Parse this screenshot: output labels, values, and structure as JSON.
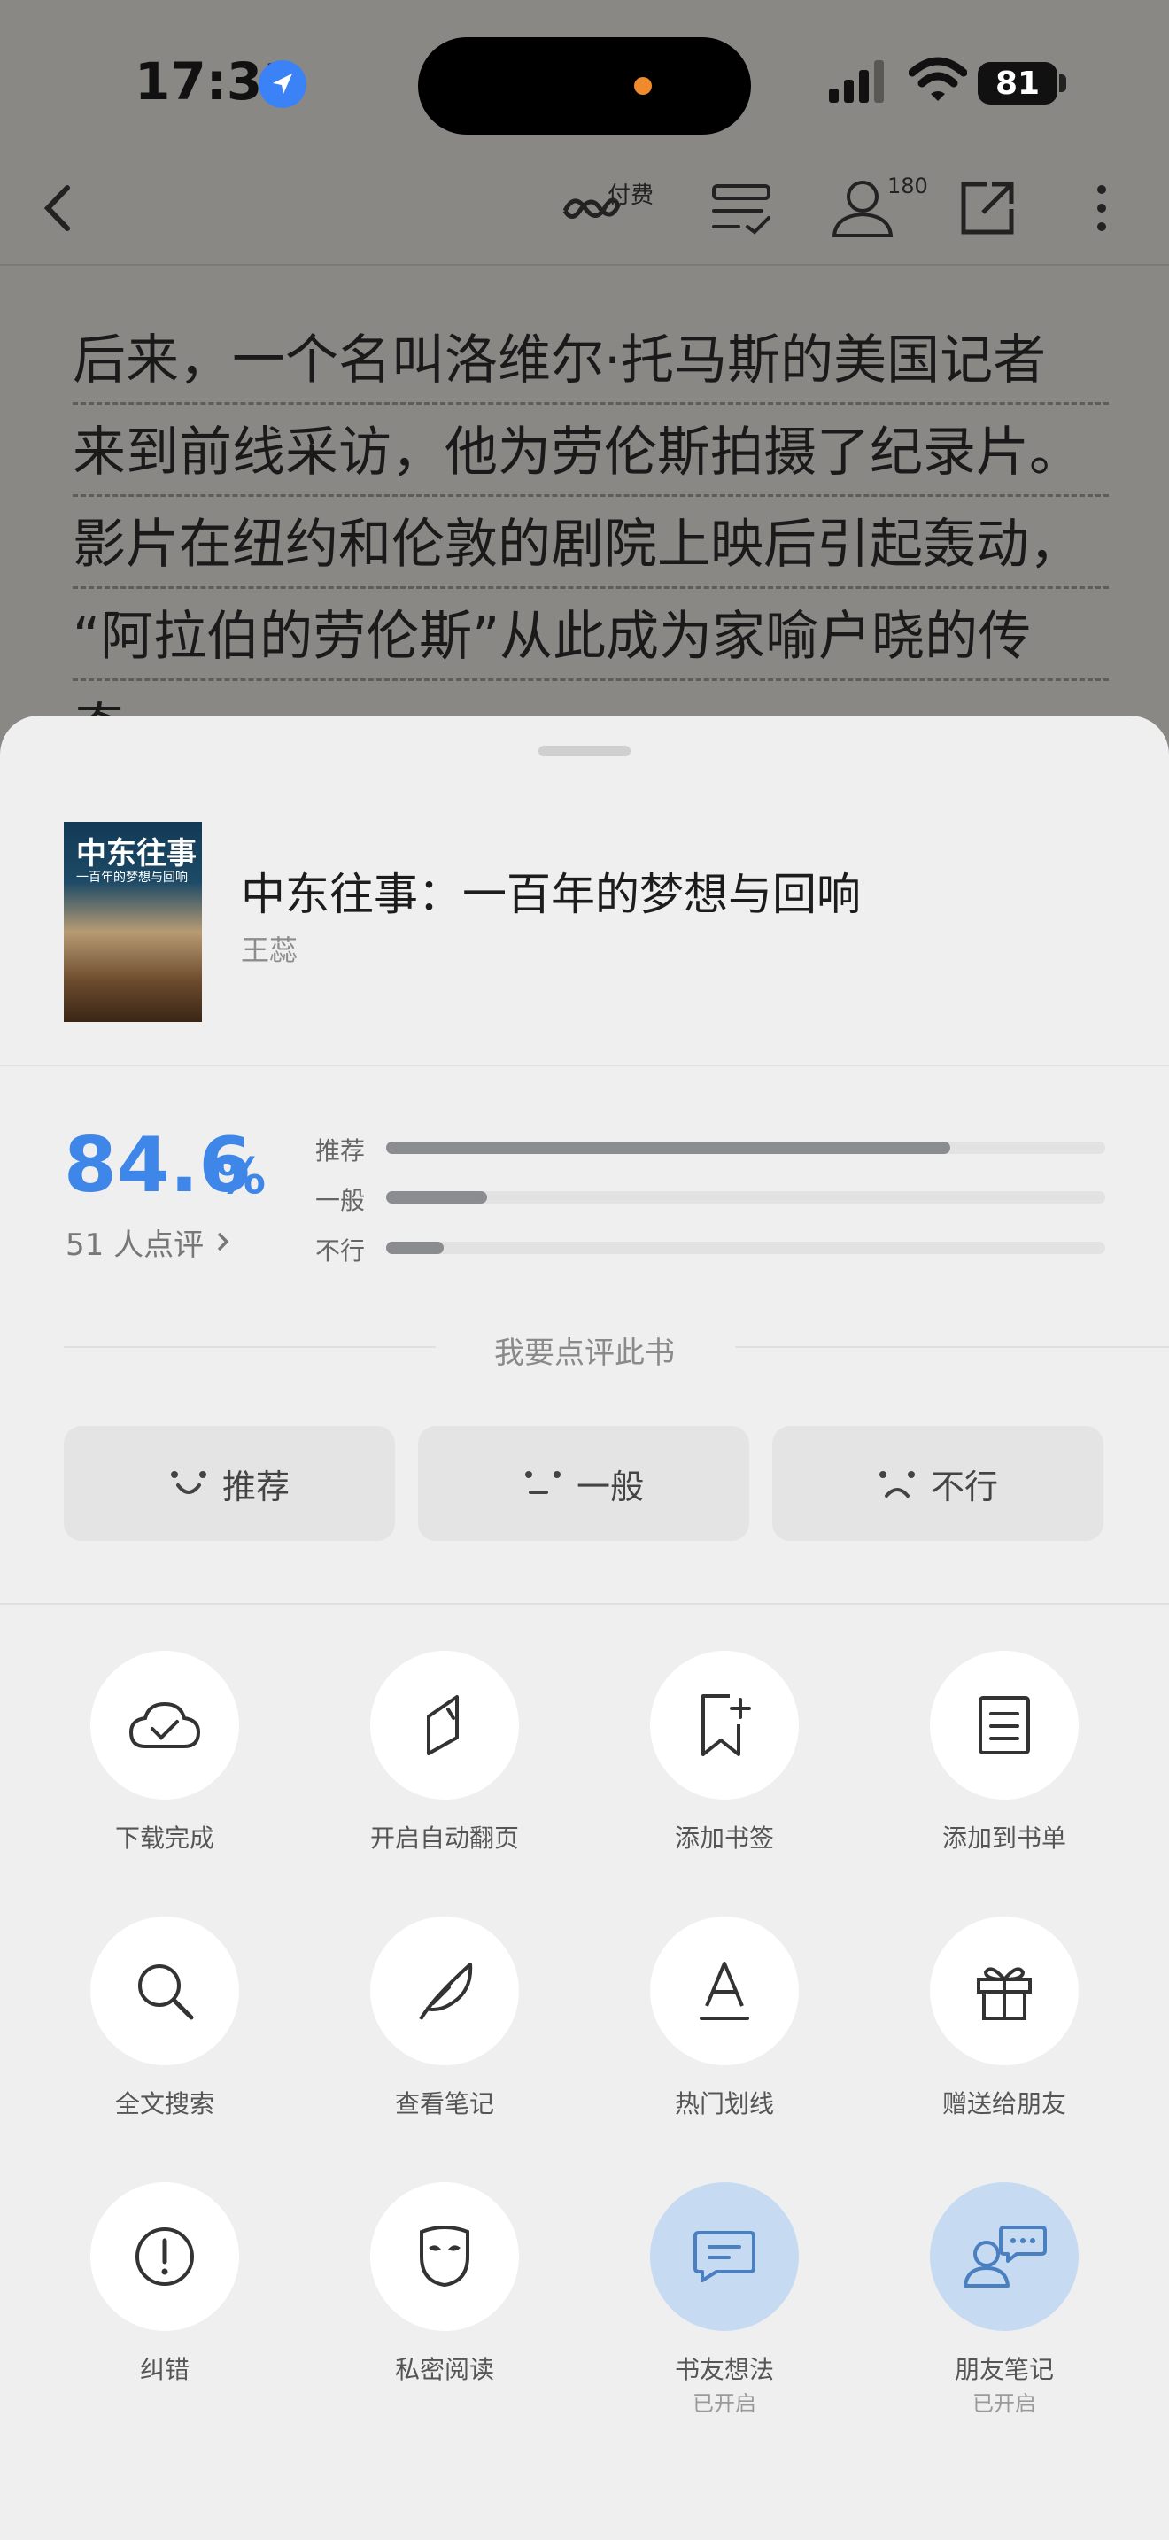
{
  "status": {
    "time": "17:31",
    "battery": "81"
  },
  "nav": {
    "paid_label": "付费",
    "reader_count": "180"
  },
  "reading": {
    "lines": [
      "后来，一个名叫洛维尔·托马斯的美国记者",
      "来到前线采访，他为劳伦斯拍摄了纪录片。",
      "影片在纽约和伦敦的剧院上映后引起轰动，",
      "“阿拉伯的劳伦斯”从此成为家喻户晓的传",
      "奇。"
    ]
  },
  "book": {
    "title": "中东往事：一百年的梦想与回响",
    "author": "王蕊",
    "cover_title": "中东往事",
    "cover_subtitle": "一百年的梦想与回响"
  },
  "rating": {
    "score": "84.6",
    "percent_sign": "%",
    "count_text": "51 人点评",
    "bars": [
      {
        "label": "推荐",
        "fraction": 0.785
      },
      {
        "label": "一般",
        "fraction": 0.14
      },
      {
        "label": "不行",
        "fraction": 0.08
      }
    ],
    "prompt": "我要点评此书",
    "buttons": [
      "推荐",
      "一般",
      "不行"
    ]
  },
  "actions": [
    {
      "label": "下载完成",
      "icon": "cloud-check-icon"
    },
    {
      "label": "开启自动翻页",
      "icon": "page-flip-icon"
    },
    {
      "label": "添加书签",
      "icon": "bookmark-add-icon"
    },
    {
      "label": "添加到书单",
      "icon": "booklist-icon"
    },
    {
      "label": "全文搜索",
      "icon": "search-icon"
    },
    {
      "label": "查看笔记",
      "icon": "feather-icon"
    },
    {
      "label": "热门划线",
      "icon": "underline-a-icon"
    },
    {
      "label": "赠送给朋友",
      "icon": "gift-icon"
    },
    {
      "label": "纠错",
      "icon": "alert-circle-icon"
    },
    {
      "label": "私密阅读",
      "icon": "mask-icon"
    },
    {
      "label": "书友想法",
      "icon": "comment-icon",
      "sub": "已开启"
    },
    {
      "label": "朋友笔记",
      "icon": "friends-chat-icon",
      "sub": "已开启"
    }
  ],
  "colors": {
    "accent": "#3e86e8",
    "enabled_circle": "#c6daf2"
  }
}
